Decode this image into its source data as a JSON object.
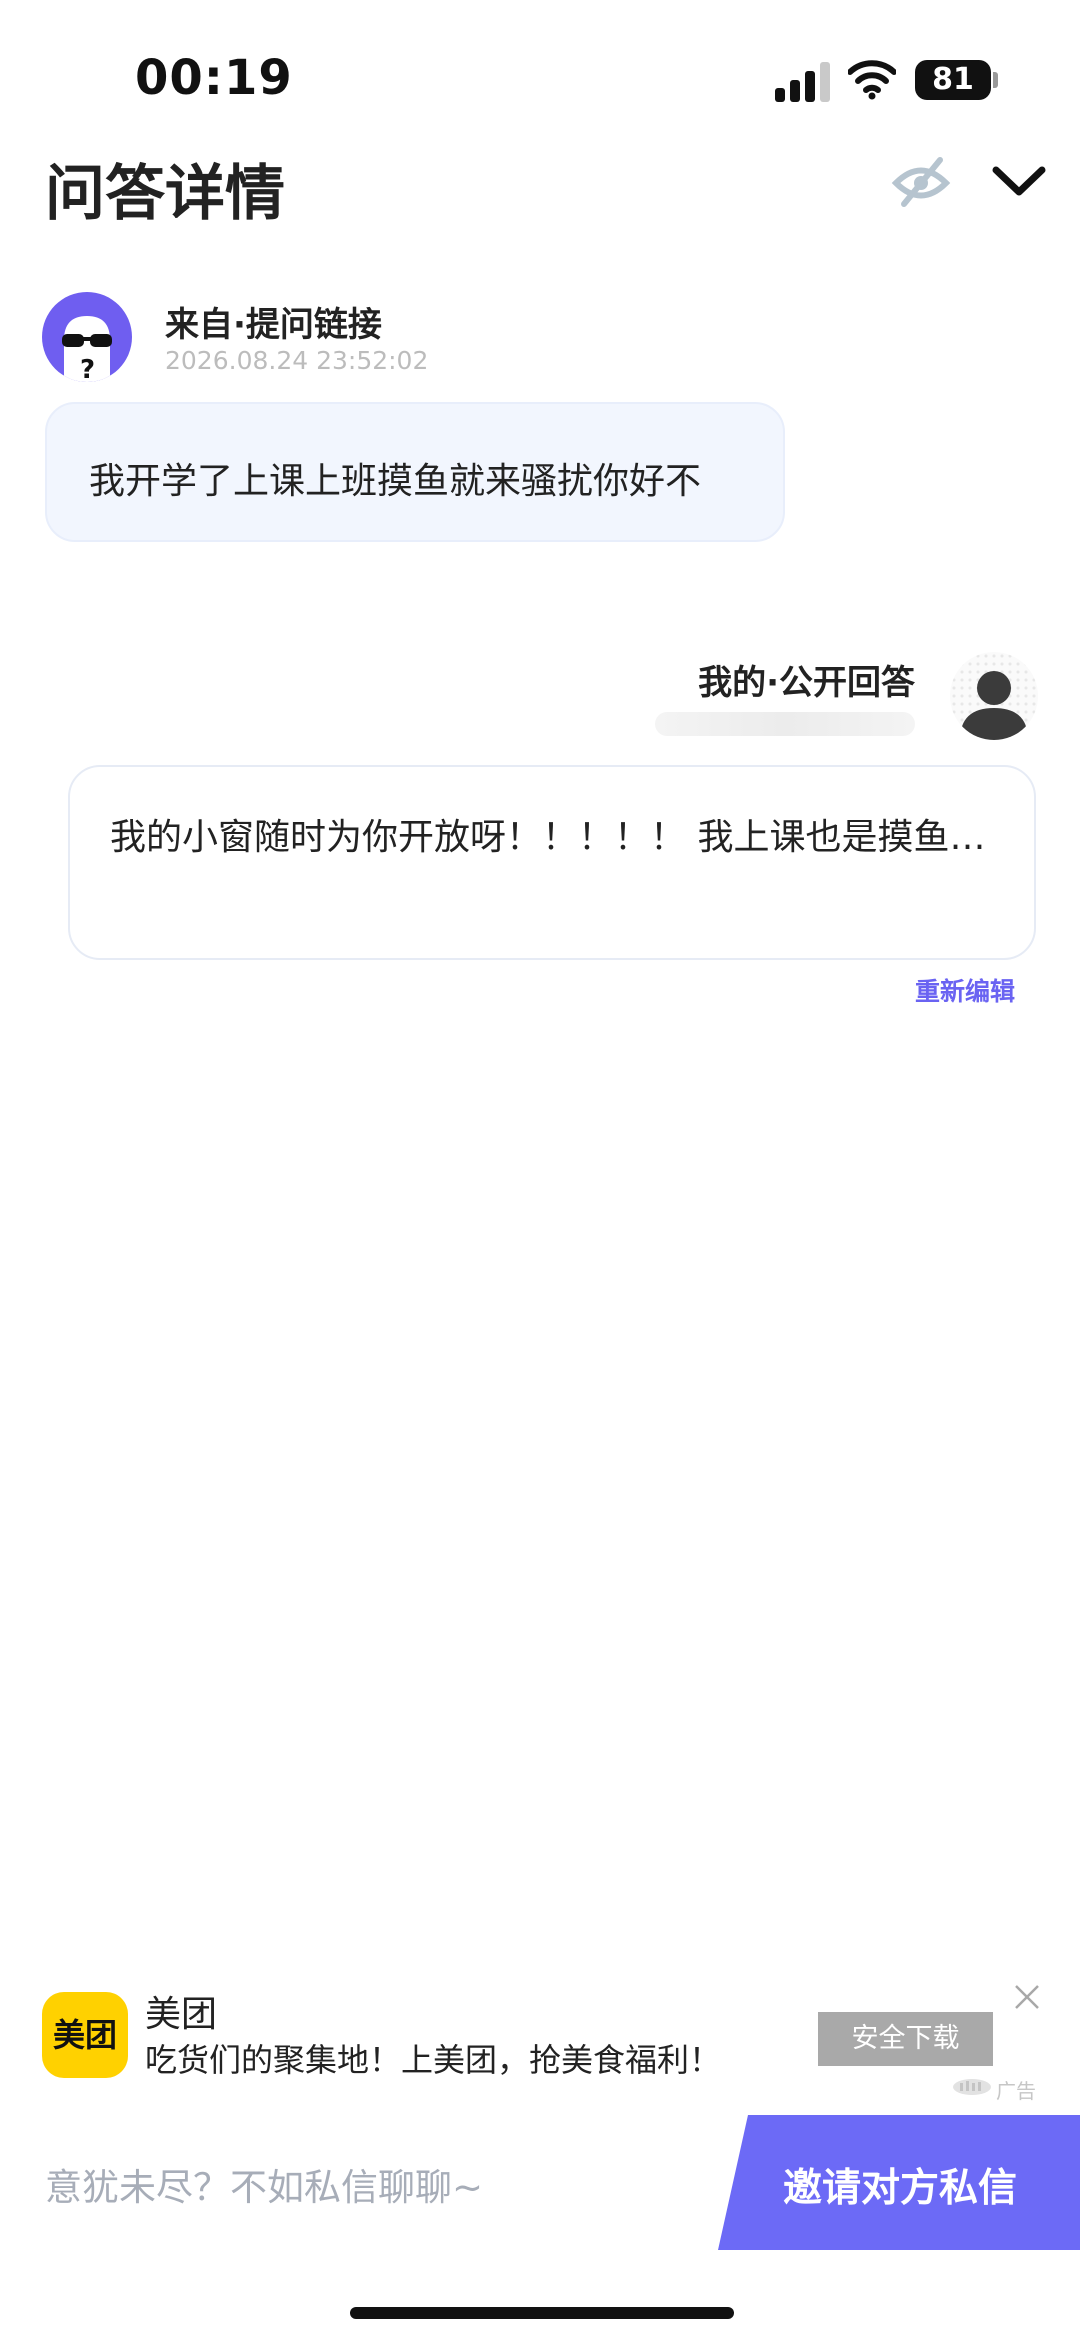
{
  "status_bar": {
    "time": "00:19",
    "battery": "81",
    "icons": [
      "signal-icon",
      "wifi-icon",
      "battery-icon"
    ]
  },
  "header": {
    "title": "问答详情",
    "icons": [
      "hide-eye-icon",
      "chevron-down-icon"
    ]
  },
  "question": {
    "source": "来自·提问链接",
    "time": "2026.08.24 23:52:02",
    "text": "我开学了上课上班摸鱼就来骚扰你好不"
  },
  "answer": {
    "label": "我的·公开回答",
    "text": "我的小窗随时为你开放呀！！！！！ 我上课也是摸鱼…",
    "re_edit": "重新编辑"
  },
  "ad": {
    "logo_text": "美团",
    "name": "美团",
    "slogan": "吃货们的聚集地！上美团，抢美食福利！",
    "download": "安全下载",
    "tag": "广告"
  },
  "bottom_bar": {
    "placeholder": "意犹未尽？不如私信聊聊~",
    "invite": "邀请对方私信"
  },
  "colors": {
    "accent": "#6c6af6",
    "question_bubble": "#f2f6fe",
    "brand_yellow": "#ffd100"
  }
}
